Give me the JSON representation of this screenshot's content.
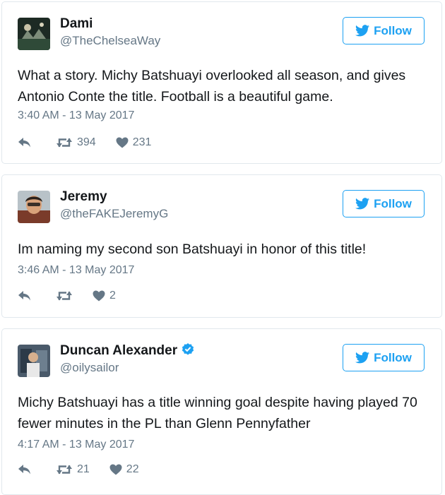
{
  "follow_label": "Follow",
  "colors": {
    "accent": "#1da1f2",
    "muted": "#657786",
    "text": "#14171a",
    "border": "#e1e8ed"
  },
  "tweets": [
    {
      "name": "Dami",
      "handle": "@TheChelseaWay",
      "verified": false,
      "text": "What a story. Michy Batshuayi overlooked all season, and gives Antonio Conte the title. Football is a beautiful game.",
      "timestamp": "3:40 AM - 13 May 2017",
      "retweets": "394",
      "likes": "231"
    },
    {
      "name": "Jeremy",
      "handle": "@theFAKEJeremyG",
      "verified": false,
      "text": "Im naming my second son Batshuayi in honor of this title!",
      "timestamp": "3:46 AM - 13 May 2017",
      "retweets": "",
      "likes": "2"
    },
    {
      "name": "Duncan Alexander",
      "handle": "@oilysailor",
      "verified": true,
      "text": "Michy Batshuayi has a title winning goal despite having played 70 fewer minutes in the PL than Glenn Pennyfather",
      "timestamp": "4:17 AM - 13 May 2017",
      "retweets": "21",
      "likes": "22"
    }
  ]
}
